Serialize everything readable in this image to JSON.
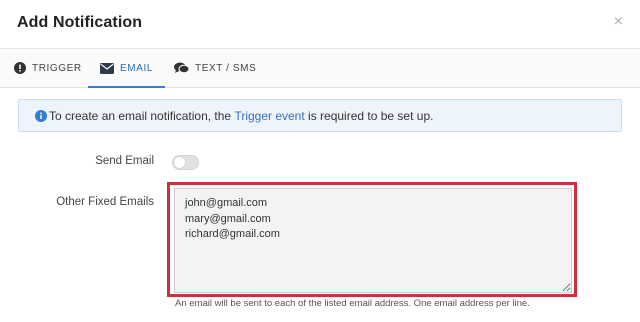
{
  "dialog": {
    "title": "Add Notification",
    "close_symbol": "×"
  },
  "tabs": [
    {
      "label": "TRIGGER",
      "icon": "exclamation-circle-icon",
      "active": false
    },
    {
      "label": "EMAIL",
      "icon": "envelope-icon",
      "active": true
    },
    {
      "label": "TEXT / SMS",
      "icon": "comments-icon",
      "active": false
    }
  ],
  "info": {
    "text_before": "To create an email notification, the ",
    "link": "Trigger event",
    "text_after": " is required to be set up.",
    "icon": "info-circle-icon"
  },
  "form": {
    "send_email_label": "Send Email",
    "send_email_enabled": false,
    "other_fixed_emails_label": "Other Fixed Emails",
    "other_fixed_emails_value": "john@gmail.com\nmary@gmail.com\nrichard@gmail.com",
    "help_text": "An email will be sent to each of the listed email address. One email address per line."
  },
  "colors": {
    "accent": "#3a7bd5",
    "link": "#3a6fb5",
    "highlight": "#d0303d",
    "info_bg": "#eef4fb"
  }
}
